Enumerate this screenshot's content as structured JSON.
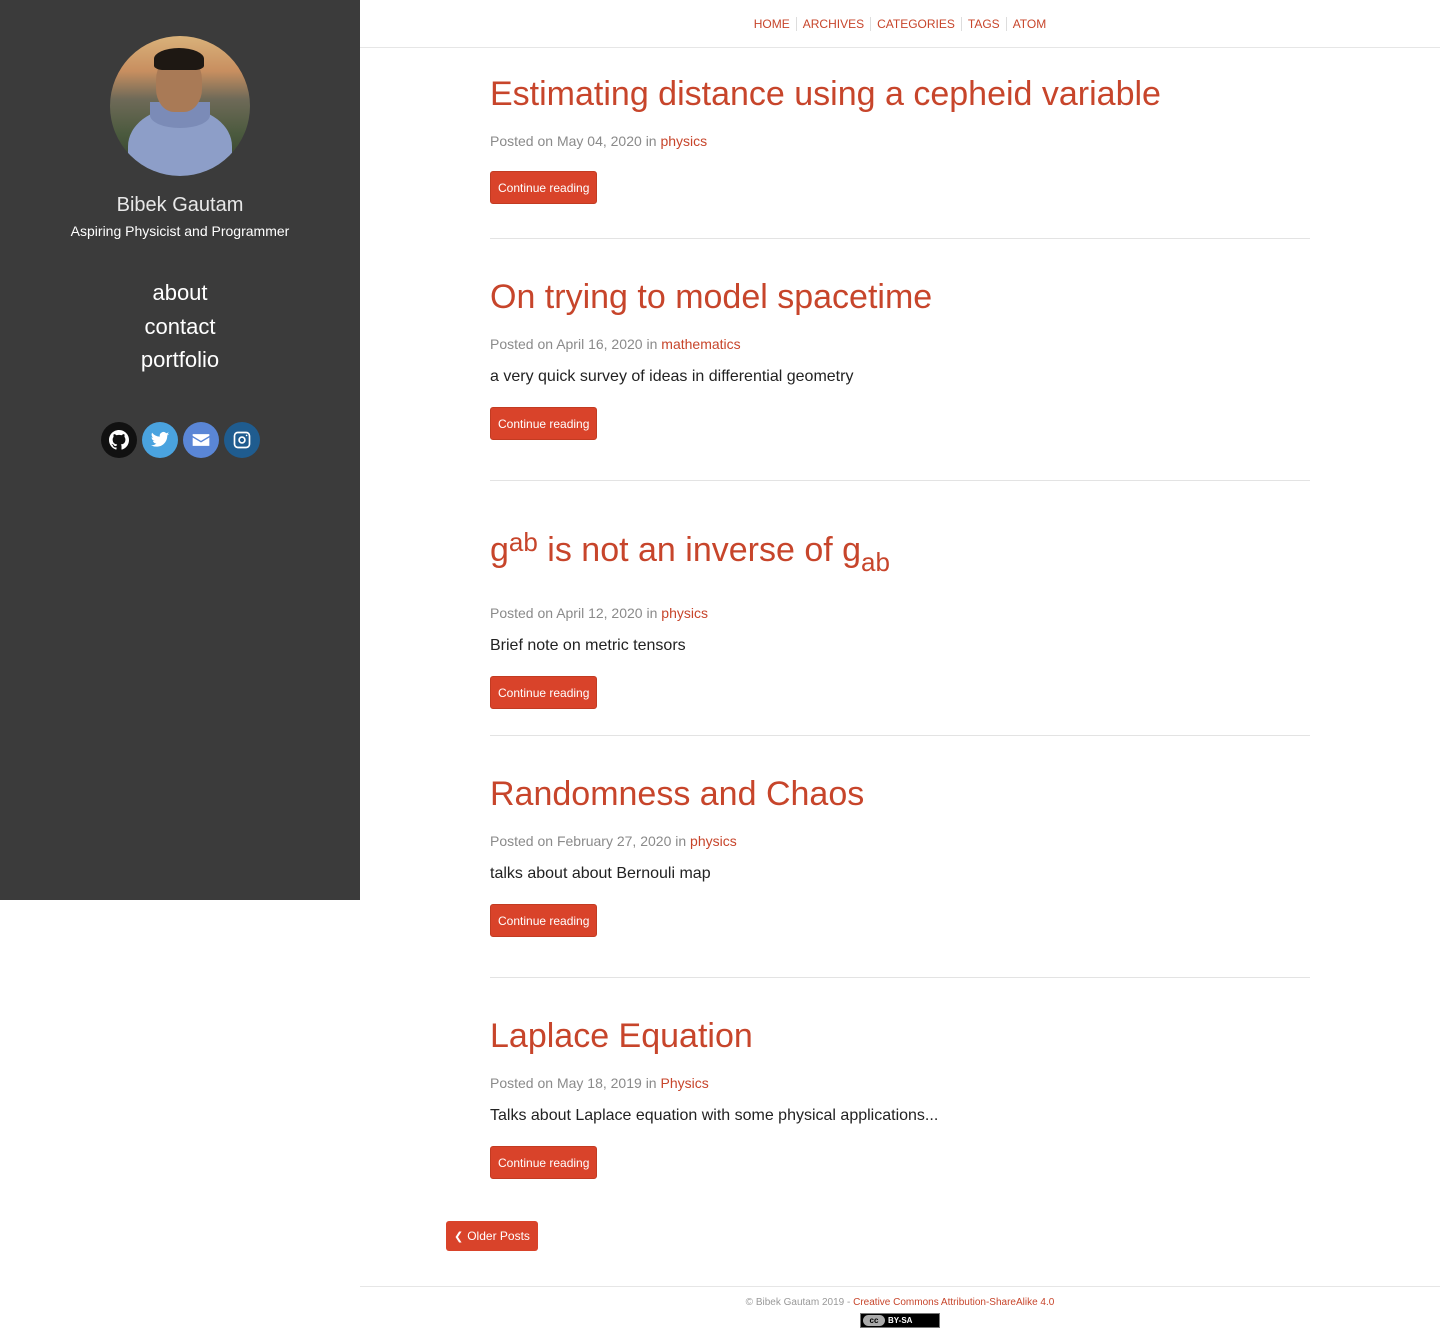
{
  "sidebar": {
    "name": "Bibek Gautam",
    "tagline": "Aspiring Physicist and Programmer",
    "nav": [
      "about",
      "contact",
      "portfolio"
    ],
    "social": [
      "github-icon",
      "twitter-icon",
      "envelope-icon",
      "instagram-icon"
    ]
  },
  "topnav": [
    "Home",
    "Archives",
    "Categories",
    "Tags",
    "Atom"
  ],
  "posts": [
    {
      "title": "Estimating distance using a cepheid variable",
      "date": "May 04, 2020",
      "category": "physics",
      "summary": ""
    },
    {
      "title": "On trying to model spacetime",
      "date": "April 16, 2020",
      "category": "mathematics",
      "summary": "a very quick survey of ideas in differential geometry"
    },
    {
      "title_base1": "g",
      "title_sup": "ab",
      "title_mid": " is not an inverse of g",
      "title_sub": "ab",
      "date": "April 12, 2020",
      "category": "physics",
      "summary": "Brief note on metric tensors"
    },
    {
      "title": "Randomness and Chaos",
      "date": "February 27, 2020",
      "category": "physics",
      "summary": "talks about about Bernouli map"
    },
    {
      "title": "Laplace Equation",
      "date": "May 18, 2019",
      "category": "Physics",
      "summary": "Talks about Laplace equation with some physical applications..."
    }
  ],
  "labels": {
    "posted_on": "Posted on",
    "in": "in",
    "continue": "Continue reading",
    "older": "Older Posts"
  },
  "footer": {
    "copyright": "© Bibek Gautam 2019 -",
    "license": "Creative Commons Attribution-ShareAlike 4.0",
    "badge_left": "cc",
    "badge_right": "BY-SA"
  },
  "colors": {
    "accent": "#c7452b",
    "sidebar_bg": "#3b3b3b",
    "button": "#d9432a"
  }
}
